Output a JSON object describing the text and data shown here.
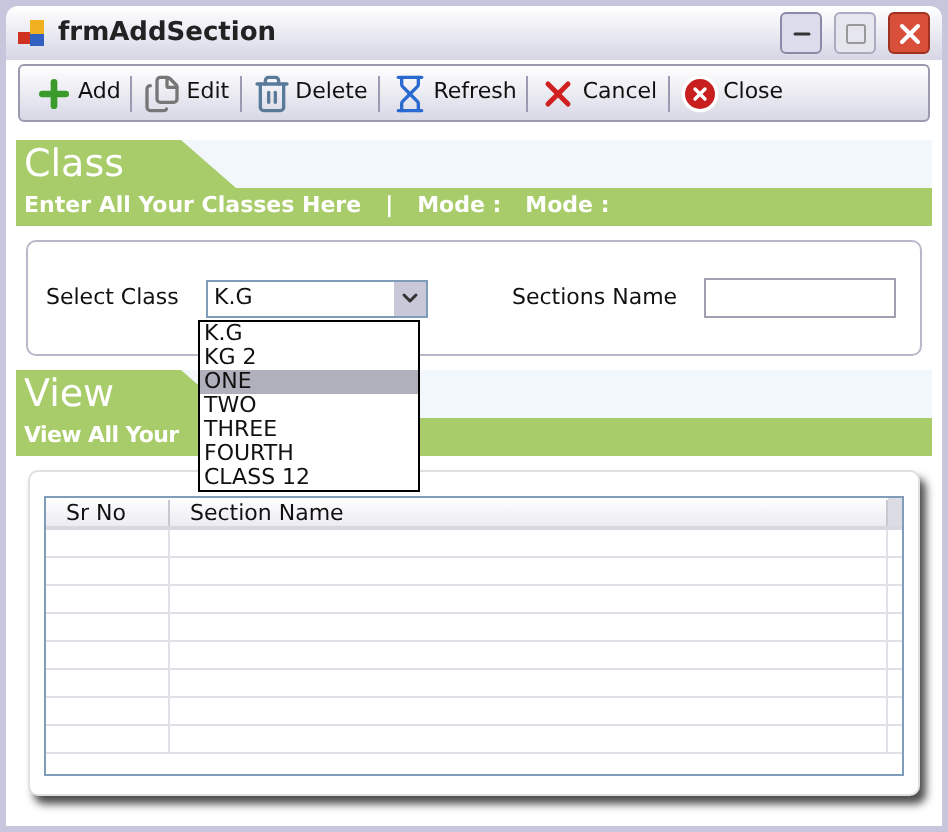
{
  "window": {
    "title": "frmAddSection"
  },
  "toolbar": [
    {
      "label": "Add",
      "kind": "add"
    },
    {
      "label": "Edit",
      "kind": "edit"
    },
    {
      "label": "Delete",
      "kind": "delete"
    },
    {
      "label": "Refresh",
      "kind": "refresh"
    },
    {
      "label": "Cancel",
      "kind": "cancel"
    },
    {
      "label": "Close",
      "kind": "close"
    }
  ],
  "class_section": {
    "heading": "Class",
    "subtitle": "Enter All Your Classes Here",
    "separator": "|",
    "mode_labels": [
      "Mode :",
      "Mode :"
    ]
  },
  "form": {
    "select_label": "Select Class",
    "select_value": "K.G",
    "sections_label": "Sections Name",
    "dropdown_options": [
      {
        "label": "K.G",
        "selected": false
      },
      {
        "label": "KG 2",
        "selected": false
      },
      {
        "label": "ONE",
        "selected": true
      },
      {
        "label": "TWO",
        "selected": false
      },
      {
        "label": "THREE",
        "selected": false
      },
      {
        "label": "FOURTH",
        "selected": false
      },
      {
        "label": "CLASS 12",
        "selected": false
      }
    ]
  },
  "view_section": {
    "heading": "View",
    "subtitle": "View All Your"
  },
  "grid": {
    "columns": [
      "Sr No",
      "Section Name"
    ]
  }
}
